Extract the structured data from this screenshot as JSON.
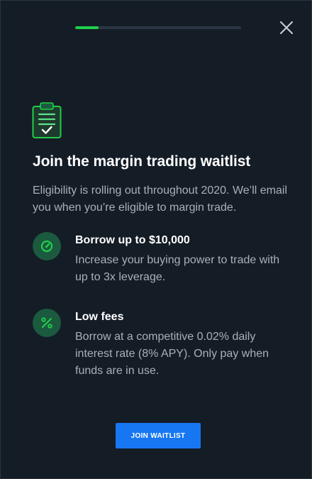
{
  "progress": {
    "fraction": 0.14
  },
  "colors": {
    "accent_green": "#21ce48",
    "icon_circle": "#1b5a3f",
    "primary_button": "#1777f2",
    "panel_background": "#141c26"
  },
  "header": {
    "close_icon": "close-icon"
  },
  "hero": {
    "icon": "clipboard-check-icon",
    "title": "Join the margin trading waitlist",
    "subtitle": "Eligibility is rolling out throughout 2020. We’ll email you when you’re eligible to margin trade."
  },
  "features": [
    {
      "icon": "gauge-icon",
      "title": "Borrow up to $10,000",
      "description": "Increase your buying power to trade with up to 3x leverage."
    },
    {
      "icon": "percent-icon",
      "title": "Low fees",
      "description": "Borrow at a competitive 0.02% daily interest rate (8% APY). Only pay when funds are in use."
    }
  ],
  "actions": {
    "join_label": "JOIN WAITLIST"
  }
}
